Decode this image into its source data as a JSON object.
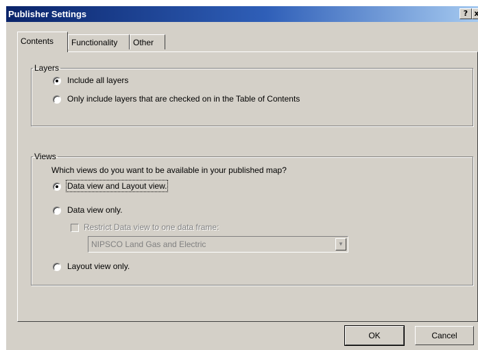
{
  "window": {
    "title": "Publisher Settings",
    "help_glyph": "?",
    "close_glyph": "x"
  },
  "tabs": [
    {
      "label": "Contents",
      "active": true
    },
    {
      "label": "Functionality",
      "active": false
    },
    {
      "label": "Other",
      "active": false
    }
  ],
  "layers": {
    "legend": "Layers",
    "options": [
      {
        "label": "Include all layers",
        "checked": true
      },
      {
        "label": "Only include layers that are checked on in the Table of Contents",
        "checked": false
      }
    ]
  },
  "views": {
    "legend": "Views",
    "question": "Which views do you want to be available in your published map?",
    "options": [
      {
        "label": "Data view and Layout view.",
        "checked": true
      },
      {
        "label": "Data view only.",
        "checked": false
      },
      {
        "label": "Layout view only.",
        "checked": false
      }
    ],
    "restrict_checkbox": {
      "label": "Restrict Data view to one data frame:",
      "checked": false,
      "enabled": false
    },
    "data_frame_select": {
      "value": "NIPSCO Land Gas and Electric",
      "enabled": false
    }
  },
  "buttons": {
    "ok": "OK",
    "cancel": "Cancel"
  },
  "colors": {
    "titlebar_start": "#0a246a",
    "titlebar_end": "#a6caf0",
    "face": "#d4d0c8"
  },
  "icons": {
    "help": "help-icon",
    "close": "close-icon",
    "dropdown": "chevron-down-icon"
  }
}
